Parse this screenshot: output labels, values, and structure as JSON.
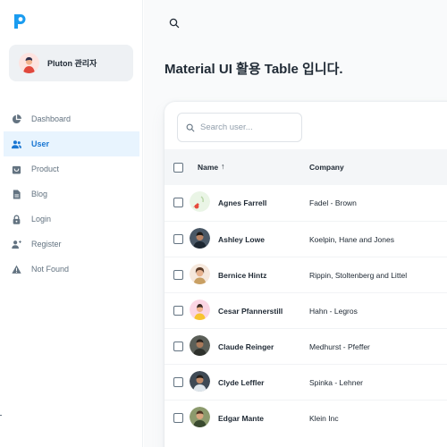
{
  "sidebar": {
    "account_name": "Pluton 관리자",
    "items": [
      {
        "label": "Dashboard",
        "icon": "pie-chart-icon",
        "active": false
      },
      {
        "label": "User",
        "icon": "people-icon",
        "active": true
      },
      {
        "label": "Product",
        "icon": "shopping-bag-icon",
        "active": false
      },
      {
        "label": "Blog",
        "icon": "file-text-icon",
        "active": false
      },
      {
        "label": "Login",
        "icon": "lock-icon",
        "active": false
      },
      {
        "label": "Register",
        "icon": "person-add-icon",
        "active": false
      },
      {
        "label": "Not Found",
        "icon": "alert-triangle-icon",
        "active": false
      }
    ]
  },
  "header": {
    "search_icon": "search-icon"
  },
  "page": {
    "title": "Material UI 활용 Table 입니다."
  },
  "table": {
    "search_placeholder": "Search user...",
    "col_name": "Name",
    "sort_arrow": "↑",
    "col_company": "Company",
    "rows": [
      {
        "name": "Agnes Farrell",
        "company": "Fadel - Brown"
      },
      {
        "name": "Ashley Lowe",
        "company": "Koelpin, Hane and Jones"
      },
      {
        "name": "Bernice Hintz",
        "company": "Rippin, Stoltenberg and Littel"
      },
      {
        "name": "Cesar Pfannerstill",
        "company": "Hahn - Legros"
      },
      {
        "name": "Claude Reinger",
        "company": "Medhurst - Pfeffer"
      },
      {
        "name": "Clyde Leffler",
        "company": "Spinka - Lehner"
      },
      {
        "name": "Edgar Mante",
        "company": "Klein Inc"
      }
    ]
  },
  "colors": {
    "primary": "#1976d2",
    "active_bg": "#e8f4fe",
    "text": "#212b36",
    "muted": "#637381"
  }
}
